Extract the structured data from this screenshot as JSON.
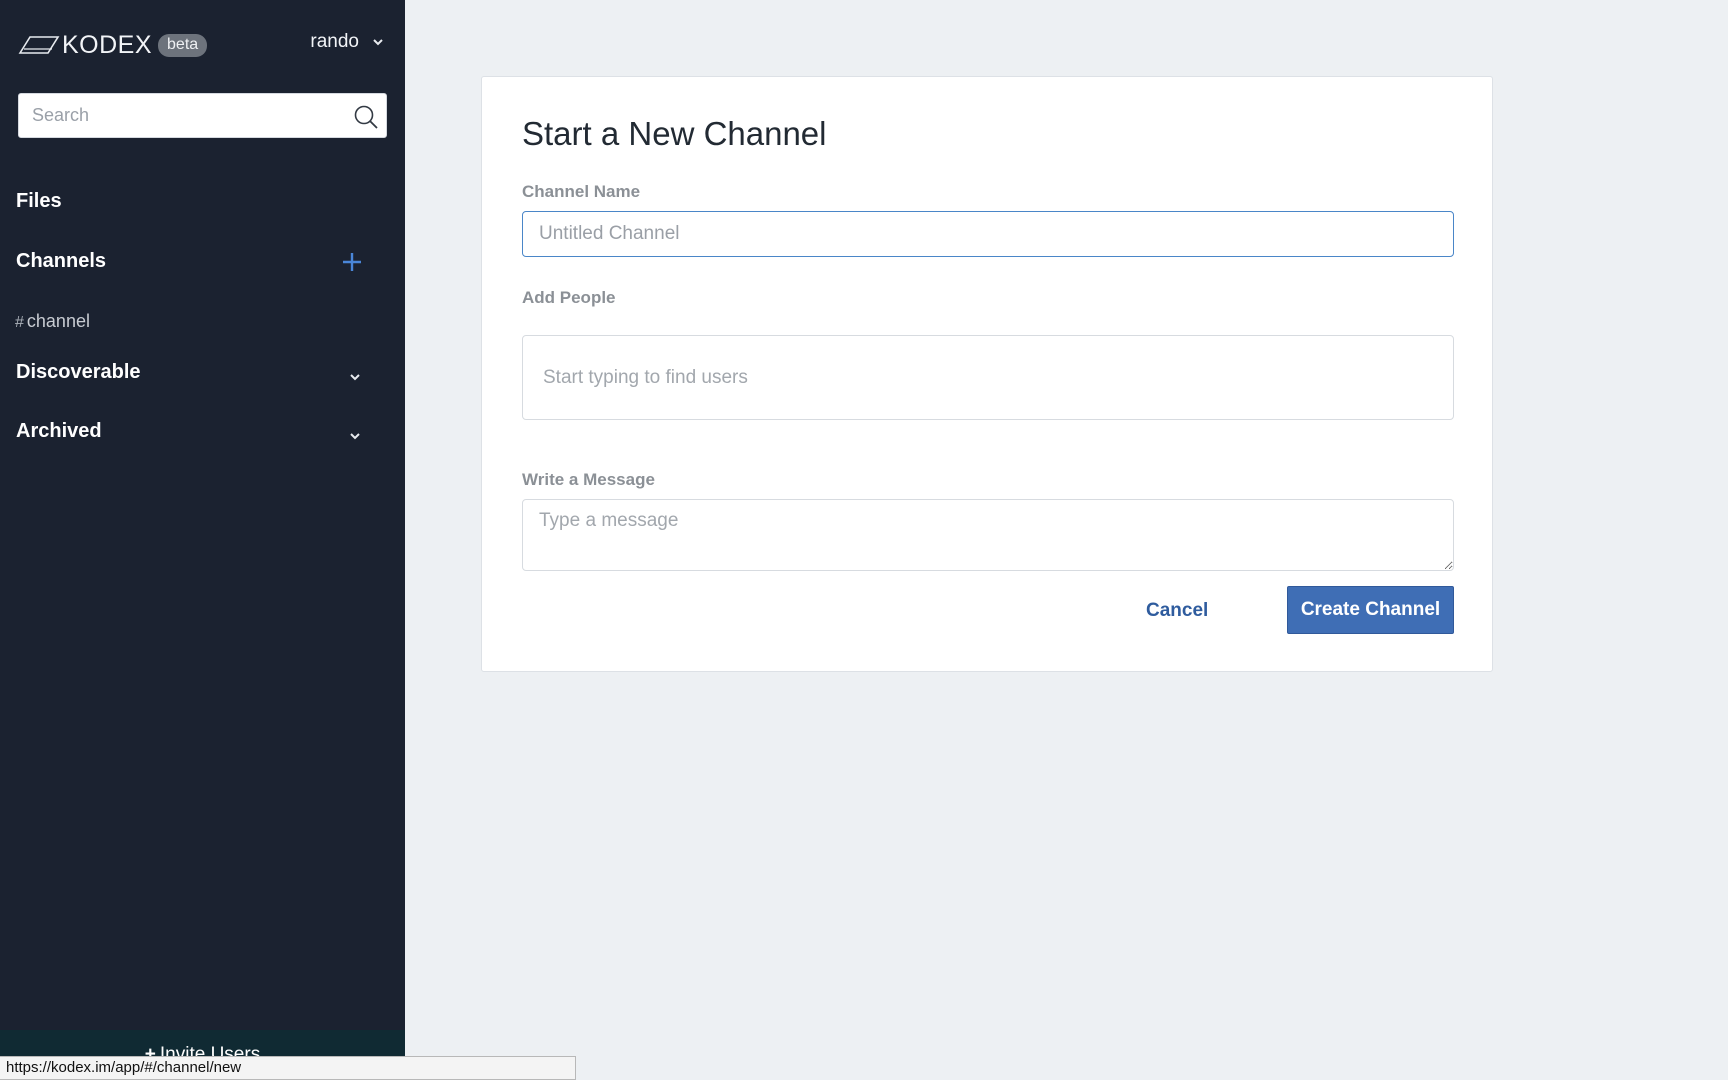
{
  "sidebar": {
    "brand": {
      "name": "KODEX",
      "badge": "beta",
      "logo_icon": "kodex-logo-icon"
    },
    "user": {
      "name": "rando",
      "icon": "chevron-down-icon"
    },
    "search": {
      "placeholder": "Search",
      "value": "",
      "icon": "search-icon"
    },
    "sections": {
      "files": "Files",
      "channels": "Channels",
      "discoverable": "Discoverable",
      "archived": "Archived"
    },
    "channels": [
      {
        "hash": "#",
        "name": "channel"
      }
    ],
    "invite_label": "Invite Users"
  },
  "main": {
    "title": "Start a New Channel",
    "channel_name": {
      "label": "Channel Name",
      "placeholder": "Untitled Channel",
      "value": ""
    },
    "add_people": {
      "label": "Add People",
      "placeholder": "Start typing to find users",
      "value": ""
    },
    "message": {
      "label": "Write a Message",
      "placeholder": "Type a message",
      "value": ""
    },
    "actions": {
      "cancel": "Cancel",
      "create": "Create Channel"
    }
  },
  "status_bar": {
    "url": "https://kodex.im/app/#/channel/new"
  },
  "colors": {
    "sidebar_bg": "#1b2230",
    "page_bg": "#edf0f3",
    "accent": "#3f6eb5",
    "link": "#2f5c9e",
    "add_icon": "#4a86d8"
  }
}
